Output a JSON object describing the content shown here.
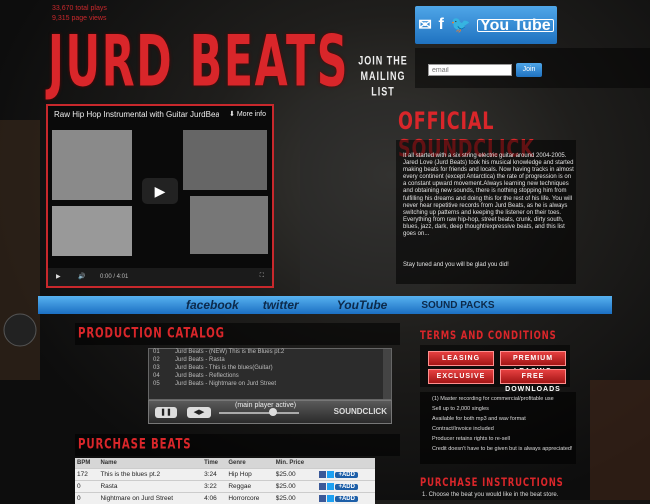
{
  "header": {
    "stats": [
      "33,670 total plays",
      "9,315 page views"
    ],
    "logo": "JURD BEATS",
    "social": {
      "email_icon": "envelope-icon",
      "facebook_icon": "f",
      "twitter_icon": "twitter-bird-icon",
      "youtube": "You Tube"
    },
    "mailing_label": "JOIN THE MAILING LIST",
    "email_placeholder": "email",
    "join_label": "Join"
  },
  "video": {
    "title": "Raw Hip Hop Instrumental with Guitar JurdBeats",
    "more_info": "More info",
    "time": "0:00 / 4:01"
  },
  "official": {
    "heading": "OFFICIAL SOUNDCLICK",
    "bio": "It all started with a six string electric guitar around 2004-2005. Jared Love (Jurd Beats) took his musical knowledge and started making beats for friends and locals. Now having tracks in almost every continent (except Antarctica) the rate of progression is on a constant upward movement.Always learning new techniques and obtaining new sounds, there is nothing stopping him from fulfilling his dreams and doing this for the rest of his life. You will never hear repetitive records from Jurd Beats, as he is always switching up patterns and keeping the listener on their toes. Everything from raw hip-hop, street beats, crunk, dirty south, blues, jazz, dark, deep thought/expressive beats, and this list goes on...",
    "closing": "Stay tuned and you will be glad you did!"
  },
  "nav": [
    "facebook",
    "twitter",
    "YouTube",
    "SOUND PACKS"
  ],
  "production": {
    "heading": "PRODUCTION CATALOG",
    "tracks": [
      {
        "n": "01",
        "title": "Jurd Beats - (NEW) This is the Blues pt.2"
      },
      {
        "n": "02",
        "title": "Jurd Beats - Rasta"
      },
      {
        "n": "03",
        "title": "Jurd Beats - This is the blues(Guitar)"
      },
      {
        "n": "04",
        "title": "Jurd Beats - Reflections"
      },
      {
        "n": "05",
        "title": "Jurd Beats - Nightmare on Jurd Street"
      }
    ],
    "status": "(main player active)",
    "brand": "SOUNDCLICK"
  },
  "terms": {
    "heading": "TERMS AND CONDITIONS",
    "buttons": [
      "LEASING",
      "PREMIUM LEASING",
      "EXCLUSIVE",
      "FREE DOWNLOADS"
    ],
    "list": [
      "(1) Master recording for commercial/profitable use",
      "Sell up to 2,000 singles",
      "Available for both mp3 and wav format",
      "Contract/Invoice included",
      "Producer retains rights to re-sell",
      "Credit doesn't have to be given but is always appreciated!"
    ]
  },
  "purchase": {
    "heading": "PURCHASE BEATS",
    "columns": [
      "BPM",
      "Name",
      "Time",
      "Genre",
      "Min. Price"
    ],
    "rows": [
      {
        "bpm": "172",
        "name": "This is the blues pt.2",
        "time": "3:24",
        "genre": "Hip Hop",
        "price": "$25.00",
        "add": "+ADD"
      },
      {
        "bpm": "0",
        "name": "Rasta",
        "time": "3:22",
        "genre": "Reggae",
        "price": "$25.00",
        "add": "+ADD"
      },
      {
        "bpm": "0",
        "name": "Nightmare on Jurd Street",
        "time": "4:06",
        "genre": "Horrorcore",
        "price": "$25.00",
        "add": "+ADD"
      }
    ]
  },
  "instructions": {
    "heading": "PURCHASE INSTRUCTIONS",
    "step1": "1. Choose the beat you would like in the beat store."
  },
  "colors": {
    "accent_red": "#d9262a",
    "nav_blue": "#2a86d8"
  }
}
